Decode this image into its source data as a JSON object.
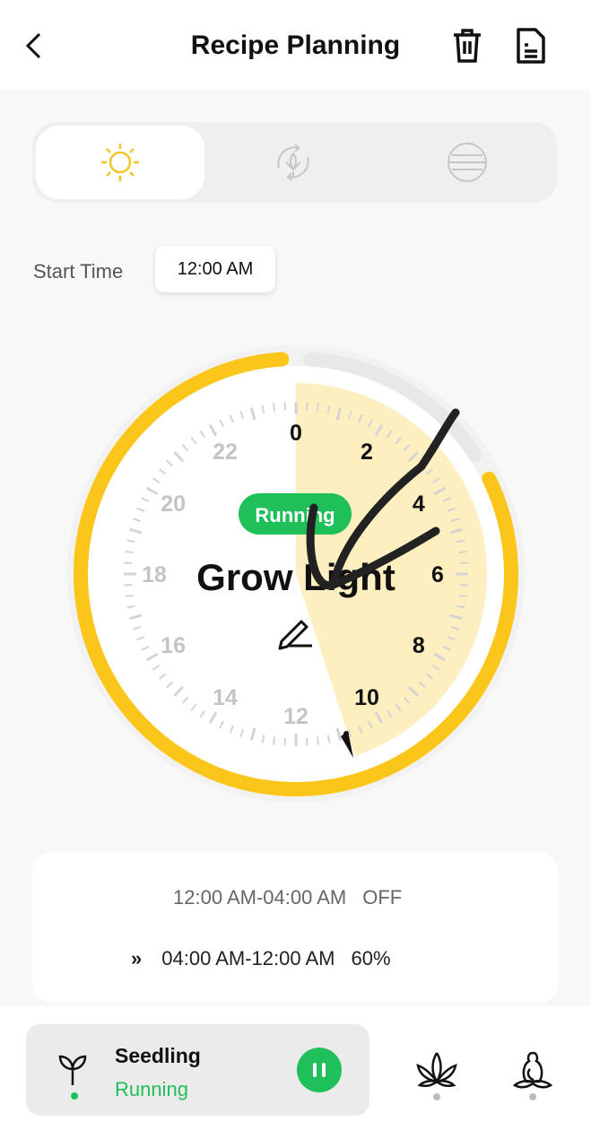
{
  "header": {
    "title": "Recipe Planning",
    "back_icon": "chevron-left-icon",
    "delete_icon": "trash-icon",
    "doc_icon": "document-icon"
  },
  "tabs": [
    {
      "icon": "sun-icon",
      "active": true
    },
    {
      "icon": "plant-cycle-icon",
      "active": false
    },
    {
      "icon": "menu-circle-icon",
      "active": false
    }
  ],
  "start_time": {
    "label": "Start Time",
    "value": "12:00 AM"
  },
  "clock": {
    "status": "Running",
    "name": "Grow Light",
    "edit_icon": "pencil-icon",
    "hours": [
      "0",
      "2",
      "4",
      "6",
      "8",
      "10",
      "12",
      "14",
      "16",
      "18",
      "20",
      "22"
    ],
    "off_range_hours": [
      0,
      4
    ],
    "on_range_hours": [
      4,
      24
    ],
    "lit_wedge_hours": [
      0,
      10.8
    ],
    "colors": {
      "on": "#fbc61a",
      "off": "#e8e8e8",
      "wedge": "#fdefbf",
      "running": "#1fc05a"
    }
  },
  "schedule": [
    {
      "range": "12:00 AM-04:00 AM",
      "value": "OFF",
      "current": false
    },
    {
      "range": "04:00 AM-12:00 AM",
      "value": "60%",
      "current": true,
      "icon": "double-chevron-right-icon"
    }
  ],
  "bottom": {
    "stage": {
      "name": "Seedling",
      "status": "Running",
      "icon": "seedling-icon",
      "button_icon": "pause-icon"
    },
    "other_stages": [
      {
        "icon": "cannabis-leaf-icon"
      },
      {
        "icon": "flowering-bud-icon"
      }
    ]
  }
}
